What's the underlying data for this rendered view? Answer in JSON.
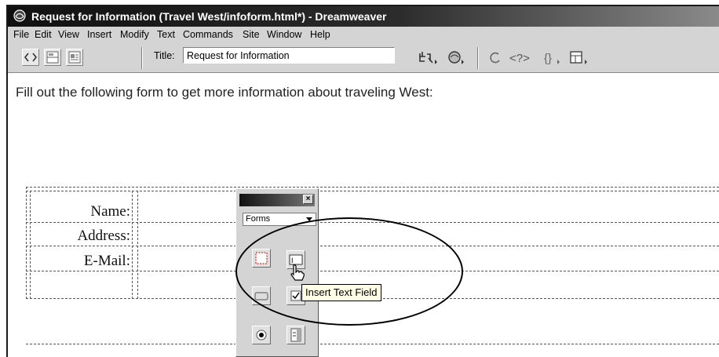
{
  "window": {
    "title": "Request for Information (Travel West/infoform.html*) - Dreamweaver"
  },
  "menubar": {
    "items": [
      "File",
      "Edit",
      "View",
      "Insert",
      "Modify",
      "Text",
      "Commands",
      "Site",
      "Window",
      "Help"
    ]
  },
  "toolbar": {
    "title_label": "Title:",
    "title_value": "Request for Information"
  },
  "document": {
    "intro_text": "Fill out the following form to get more information about traveling West:",
    "form_labels": [
      "Name:",
      "Address:",
      "E-Mail:"
    ]
  },
  "forms_panel": {
    "category": "Forms",
    "close_glyph": "×",
    "tooltip": "Insert Text Field"
  }
}
